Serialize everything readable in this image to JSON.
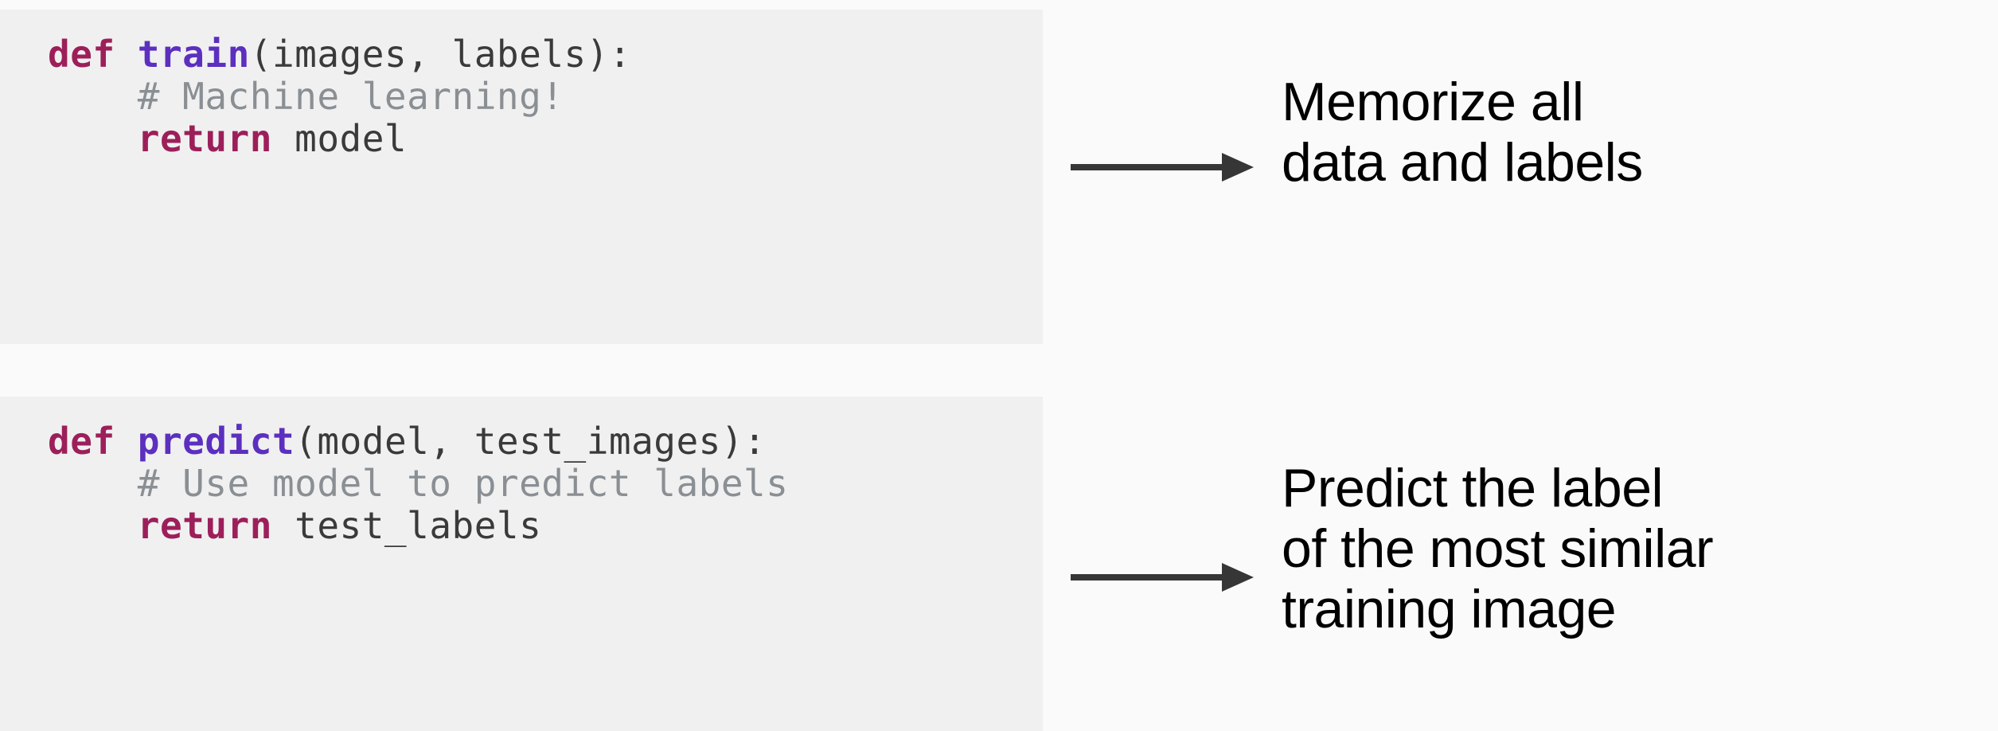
{
  "blocks": [
    {
      "code": {
        "defKw": "def",
        "fnName": "train",
        "paramsOpen": "(",
        "params": "images, labels",
        "paramsClose": "):",
        "commentIndent": "    ",
        "comment": "# Machine learning!",
        "returnIndent": "    ",
        "returnKw": "return",
        "returnSpace": " ",
        "returnVal": "model"
      },
      "description": "Memorize all\ndata and labels"
    },
    {
      "code": {
        "defKw": "def",
        "fnName": "predict",
        "paramsOpen": "(",
        "params": "model, test_images",
        "paramsClose": "):",
        "commentIndent": "    ",
        "comment": "# Use model to predict labels",
        "returnIndent": "    ",
        "returnKw": "return",
        "returnSpace": " ",
        "returnVal": "test_labels"
      },
      "description": "Predict the label\nof the most similar\ntraining image"
    }
  ],
  "watermark": ""
}
